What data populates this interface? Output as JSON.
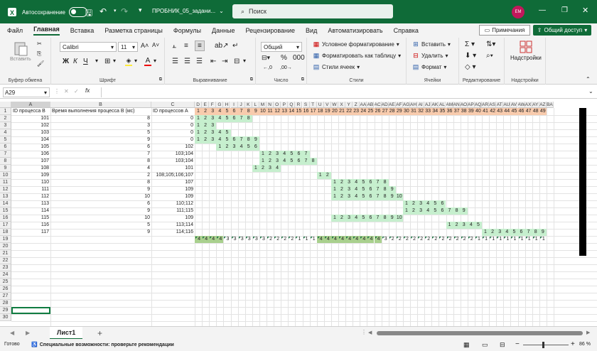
{
  "titlebar": {
    "autosave_label": "Автосохранение",
    "filename": "ПРОБНИК_05_задани...",
    "search_placeholder": "Поиск",
    "avatar_initials": "ЕМ"
  },
  "menu": {
    "tabs": [
      "Файл",
      "Главная",
      "Вставка",
      "Разметка страницы",
      "Формулы",
      "Данные",
      "Рецензирование",
      "Вид",
      "Автоматизировать",
      "Справка"
    ],
    "notes": "Примечания",
    "share": "Общий доступ"
  },
  "ribbon": {
    "paste": "Вставить",
    "clipboard": "Буфер обмена",
    "font_name": "Calibri",
    "font_size": "11",
    "font": "Шрифт",
    "alignment": "Выравнивание",
    "number_format": "Общий",
    "number": "Число",
    "cond_format": "Условное форматирование",
    "format_table": "Форматировать как таблицу",
    "cell_styles": "Стили ячеек",
    "styles": "Стили",
    "insert": "Вставить",
    "delete": "Удалить",
    "format": "Формат",
    "cells": "Ячейки",
    "editing": "Редактирование",
    "addins_btn": "Надстройки",
    "addins": "Надстройки"
  },
  "formula": {
    "namebox": "A29",
    "fx": "fx",
    "content": ""
  },
  "sheet": {
    "col_letters": [
      "D",
      "E",
      "F",
      "G",
      "H",
      "I",
      "J",
      "K",
      "L",
      "M",
      "N",
      "O",
      "P",
      "Q",
      "R",
      "S",
      "T",
      "U",
      "V",
      "W",
      "X",
      "Y",
      "Z",
      "AA",
      "AB",
      "AC",
      "AD",
      "AE",
      "AF",
      "AG",
      "AH",
      "AI",
      "AJ",
      "AK",
      "AL",
      "AM",
      "AN",
      "AO",
      "AP",
      "AQ",
      "AR",
      "AS",
      "AT",
      "AU",
      "AV",
      "AW",
      "AX",
      "AY",
      "AZ",
      "BA"
    ],
    "header_row": [
      "ID процесса B",
      "Время выполнения процесса B (мс)",
      "ID процессов A"
    ],
    "time_axis": [
      "1",
      "2",
      "3",
      "4",
      "5",
      "6",
      "7",
      "8",
      "9",
      "10",
      "11",
      "12",
      "13",
      "14",
      "15",
      "16",
      "17",
      "18",
      "19",
      "20",
      "21",
      "22",
      "23",
      "24",
      "25",
      "26",
      "27",
      "28",
      "29",
      "30",
      "31",
      "32",
      "33",
      "34",
      "35",
      "36",
      "37",
      "38",
      "39",
      "40",
      "41",
      "42",
      "43",
      "44",
      "45",
      "46",
      "47",
      "48",
      "49"
    ],
    "rows": [
      {
        "id": "101",
        "time": "8",
        "deps": "0",
        "start": 1,
        "dur": 8
      },
      {
        "id": "102",
        "time": "3",
        "deps": "0",
        "start": 1,
        "dur": 3
      },
      {
        "id": "103",
        "time": "5",
        "deps": "0",
        "start": 1,
        "dur": 5
      },
      {
        "id": "104",
        "time": "9",
        "deps": "0",
        "start": 1,
        "dur": 9
      },
      {
        "id": "105",
        "time": "6",
        "deps": "102",
        "start": 4,
        "dur": 6
      },
      {
        "id": "106",
        "time": "7",
        "deps": "103;104",
        "start": 10,
        "dur": 7
      },
      {
        "id": "107",
        "time": "8",
        "deps": "103;104",
        "start": 10,
        "dur": 8
      },
      {
        "id": "108",
        "time": "4",
        "deps": "101",
        "start": 9,
        "dur": 4
      },
      {
        "id": "109",
        "time": "2",
        "deps": "108;105;106;107",
        "start": 18,
        "dur": 2
      },
      {
        "id": "110",
        "time": "8",
        "deps": "107",
        "start": 20,
        "dur": 8
      },
      {
        "id": "111",
        "time": "9",
        "deps": "109",
        "start": 20,
        "dur": 9
      },
      {
        "id": "112",
        "time": "10",
        "deps": "109",
        "start": 20,
        "dur": 10
      },
      {
        "id": "113",
        "time": "6",
        "deps": "110;112",
        "start": 30,
        "dur": 6
      },
      {
        "id": "114",
        "time": "9",
        "deps": "111;115",
        "start": 30,
        "dur": 9
      },
      {
        "id": "115",
        "time": "10",
        "deps": "109",
        "start": 20,
        "dur": 10
      },
      {
        "id": "116",
        "time": "5",
        "deps": "113;114",
        "start": 36,
        "dur": 5
      },
      {
        "id": "117",
        "time": "9",
        "deps": "114;116",
        "start": 41,
        "dur": 9
      }
    ],
    "counts": [
      "4",
      "4",
      "4",
      "4",
      "3",
      "3",
      "3",
      "3",
      "3",
      "3",
      "2",
      "2",
      "2",
      "2",
      "1",
      "1",
      "1",
      "4",
      "4",
      "4",
      "4",
      "4",
      "4",
      "4",
      "4",
      "4",
      "3",
      "2",
      "2",
      "2",
      "2",
      "2",
      "2",
      "2",
      "2",
      "2",
      "2",
      "2",
      "2",
      "1",
      "1",
      "1",
      "1",
      "1",
      "1",
      "1",
      "1",
      "1",
      "1"
    ],
    "row_numbers": [
      "1",
      "2",
      "3",
      "4",
      "5",
      "6",
      "7",
      "8",
      "9",
      "10",
      "11",
      "12",
      "13",
      "14",
      "15",
      "16",
      "17",
      "18",
      "19",
      "20",
      "21",
      "22",
      "23",
      "24",
      "25",
      "26",
      "27",
      "28",
      "29",
      "30"
    ]
  },
  "sheetbar": {
    "tab": "Лист1"
  },
  "status": {
    "ready": "Готово",
    "accessibility": "Специальные возможности: проверьте рекомендации",
    "zoom": "86 %"
  },
  "colors": {
    "green": "#0f6b38",
    "gantt": "#c6efce",
    "axis": "#f8cbad"
  }
}
